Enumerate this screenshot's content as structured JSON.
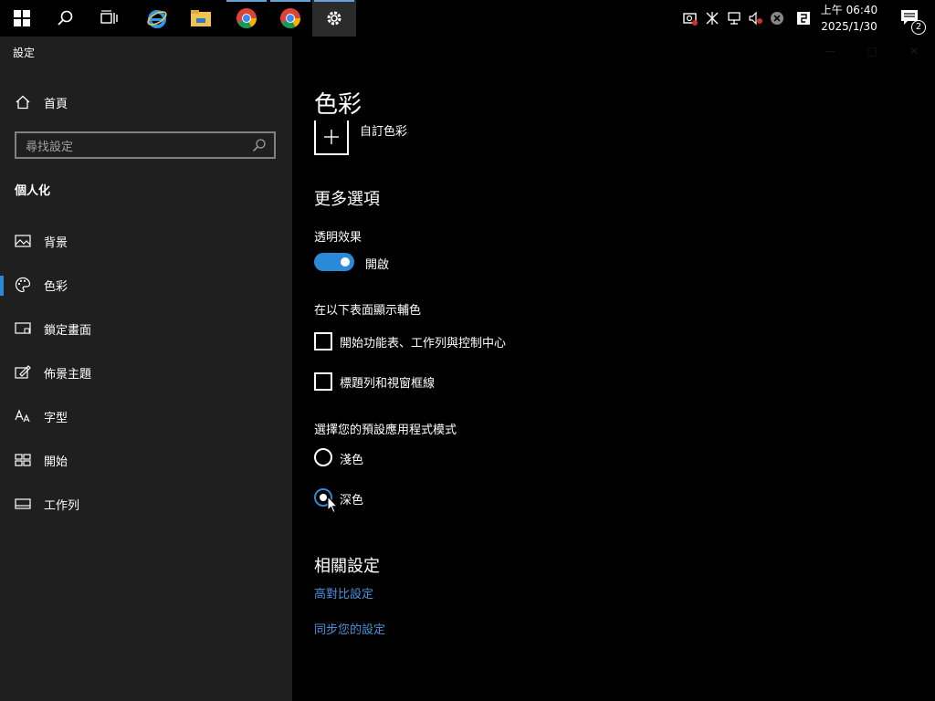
{
  "taskbar": {
    "icons": [
      "windows-start-icon",
      "search-icon",
      "task-view-icon",
      "internet-explorer-icon",
      "file-explorer-icon",
      "chrome-icon",
      "chrome-icon",
      "settings-gear-icon"
    ],
    "tray_icons": [
      "camera-icon",
      "bluetooth-icon",
      "network-icon",
      "volume-muted-icon",
      "close-circle-icon",
      "language-icon"
    ],
    "clock_time": "上午 06:40",
    "clock_date": "2025/1/30",
    "notification_count": "2"
  },
  "sidebar": {
    "app_title": "設定",
    "home_label": "首頁",
    "search_placeholder": "尋找設定",
    "section_title": "個人化",
    "items": [
      {
        "label": "背景",
        "icon": "image-icon"
      },
      {
        "label": "色彩",
        "icon": "palette-icon"
      },
      {
        "label": "鎖定畫面",
        "icon": "lock-screen-icon"
      },
      {
        "label": "佈景主題",
        "icon": "theme-brush-icon"
      },
      {
        "label": "字型",
        "icon": "font-icon"
      },
      {
        "label": "開始",
        "icon": "start-tiles-icon"
      },
      {
        "label": "工作列",
        "icon": "taskbar-icon"
      }
    ]
  },
  "main": {
    "title": "色彩",
    "custom_color_label": "自訂色彩",
    "more_options_heading": "更多選項",
    "transparency_label": "透明效果",
    "transparency_state": "開啟",
    "accent_surfaces_label": "在以下表面顯示輔色",
    "checkboxes": [
      {
        "label": "開始功能表、工作列與控制中心",
        "checked": false
      },
      {
        "label": "標題列和視窗框線",
        "checked": false
      }
    ],
    "app_mode_label": "選擇您的預設應用程式模式",
    "radios": [
      {
        "label": "淺色",
        "checked": false
      },
      {
        "label": "深色",
        "checked": true
      }
    ],
    "related_heading": "相關設定",
    "links": [
      "高對比設定",
      "同步您的設定"
    ]
  },
  "colors": {
    "accent": "#2b8ad7",
    "link": "#4a90d9",
    "sidebar_bg": "#1f1f1f",
    "main_bg": "#000000"
  }
}
